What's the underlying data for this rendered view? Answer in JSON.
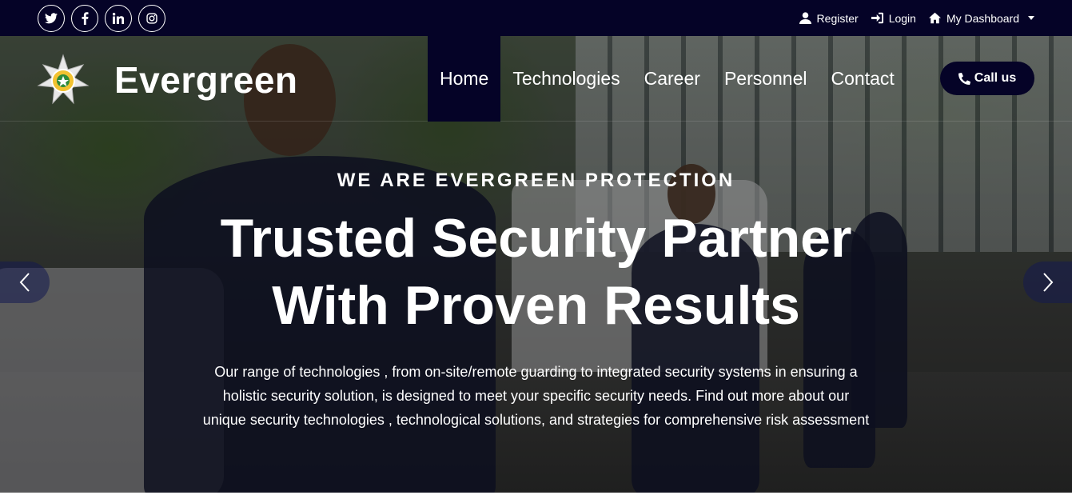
{
  "topbar": {
    "social": [
      {
        "name": "twitter-icon",
        "glyph": "t"
      },
      {
        "name": "facebook-icon",
        "glyph": "f"
      },
      {
        "name": "linkedin-icon",
        "glyph": "in"
      },
      {
        "name": "instagram-icon",
        "glyph": "◎"
      }
    ],
    "register_label": "Register",
    "login_label": "Login",
    "dashboard_label": "My Dashboard"
  },
  "navbar": {
    "brand": "Evergreen",
    "items": [
      {
        "label": "Home",
        "active": true
      },
      {
        "label": "Technologies",
        "active": false
      },
      {
        "label": "Career",
        "active": false
      },
      {
        "label": "Personnel",
        "active": false
      },
      {
        "label": "Contact",
        "active": false
      }
    ],
    "call_label": "Call us"
  },
  "hero": {
    "eyebrow": "WE ARE EVERGREEN PROTECTION",
    "headline_line1": "Trusted Security Partner",
    "headline_line2": "With Proven Results",
    "description": "Our range of technologies , from on-site/remote guarding to integrated security systems in ensuring a holistic security solution, is designed to meet your specific security needs. Find out more about our unique security technologies , technological solutions, and strategies for comprehensive risk assessment"
  },
  "colors": {
    "topbar_bg": "#050327",
    "accent": "#050327",
    "text": "#ffffff"
  }
}
